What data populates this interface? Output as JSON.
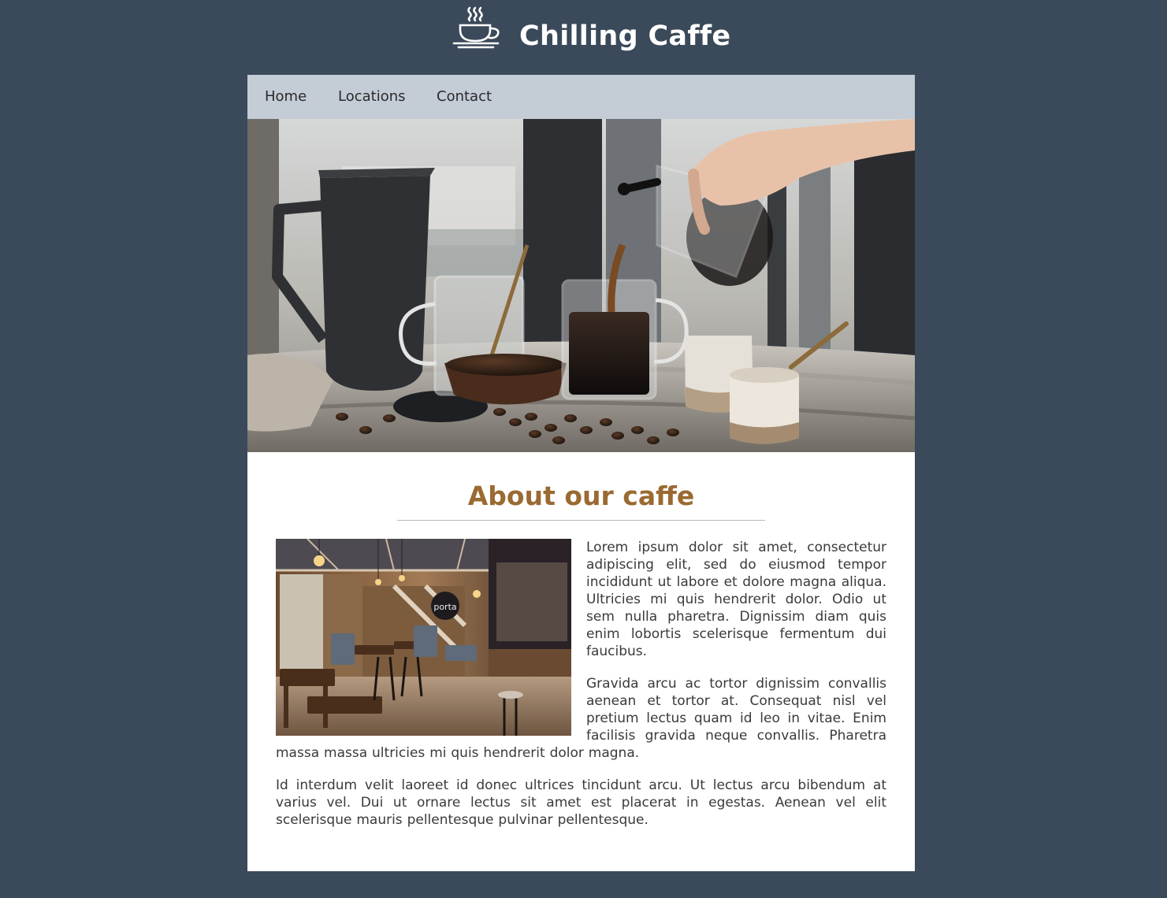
{
  "header": {
    "title": "Chilling Caffe",
    "logo_icon": "coffee-cup-icon"
  },
  "nav": {
    "items": [
      {
        "label": "Home"
      },
      {
        "label": "Locations"
      },
      {
        "label": "Contact"
      }
    ]
  },
  "about": {
    "title": "About our caffe",
    "paragraphs": [
      "Lorem ipsum dolor sit amet, consectetur adipiscing elit, sed do eiusmod tempor incididunt ut labore et dolore magna aliqua. Ultricies mi quis hendrerit dolor. Odio ut sem nulla pharetra. Dignissim diam quis enim lobortis scelerisque fermentum dui faucibus.",
      "Gravida arcu ac tortor dignissim convallis aenean et tortor at. Consequat nisl vel pretium lectus quam id leo in vitae. Enim facilisis gravida neque convallis. Pharetra massa massa ultricies mi quis hendrerit dolor magna.",
      "Id interdum velit laoreet id donec ultrices tincidunt arcu. Ut lectus arcu bibendum at varius vel. Dui ut ornare lectus sit amet est placerat in egestas. Aenean vel elit scelerisque mauris pellentesque pulvinar pellentesque."
    ],
    "interior_sign": "porta"
  },
  "colors": {
    "page_background": "#3b4a5a",
    "nav_background": "#c4ccd6",
    "heading_accent": "#9a6a32",
    "body_text": "#3a3a3a"
  }
}
